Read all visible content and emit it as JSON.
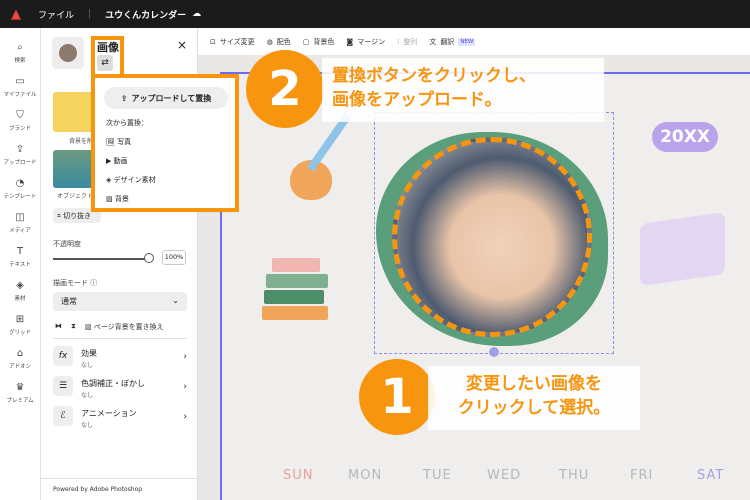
{
  "topbar": {
    "file": "ファイル",
    "doc_title": "ユウくんカレンダー"
  },
  "rail": [
    "検索",
    "マイファイル",
    "ブランド",
    "アップロード",
    "テンプレート",
    "メディア",
    "テキスト",
    "素材",
    "グリッド",
    "アドオン",
    "プレミアム"
  ],
  "panel": {
    "title": "画像",
    "thumb1_label": "背景を削",
    "thumb2_label": "オブジェクト",
    "crop": "切り抜き",
    "opacity_label": "不透明度",
    "opacity_value": "100%",
    "opacity": 1.0,
    "blend_label": "描画モード",
    "blend_value": "通常",
    "replace_bg": "ページ背景を置き換え",
    "effects": [
      {
        "title": "効果",
        "sub": "なし"
      },
      {
        "title": "色調補正・ぼかし",
        "sub": "なし"
      },
      {
        "title": "アニメーション",
        "sub": "なし"
      }
    ],
    "footer": "Powered by Adobe Photoshop"
  },
  "popup": {
    "upload": "アップロードして置換",
    "from": "次から置換：",
    "items": [
      "写真",
      "動画",
      "デザイン素材",
      "背景"
    ]
  },
  "toolbar": {
    "resize": "サイズ変更",
    "color": "配色",
    "bg": "背景色",
    "margin": "マージン",
    "align": "整列",
    "translate": "翻訳",
    "new": "NEW"
  },
  "canvas": {
    "year": "20XX",
    "days": [
      "SUN",
      "MON",
      "TUE",
      "WED",
      "THU",
      "FRI",
      "SAT"
    ],
    "colors": {
      "sun": "#e8a0a0",
      "sat": "#a9a0e0"
    }
  },
  "annotations": {
    "step2_num": "2",
    "step2": [
      "置換ボタンをクリックし、",
      "画像をアップロード。"
    ],
    "step1_num": "1",
    "step1": [
      "変更したい画像を",
      "クリックして選択。"
    ],
    "accent": "#f7950f"
  }
}
